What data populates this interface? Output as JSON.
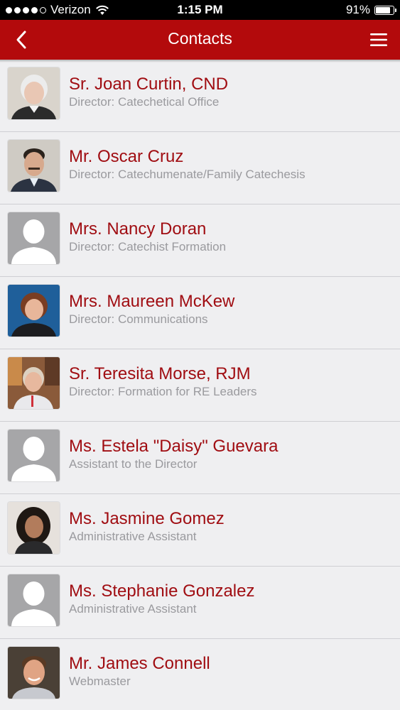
{
  "status_bar": {
    "carrier": "Verizon",
    "time": "1:15 PM",
    "battery": "91%",
    "battery_level": 0.91,
    "signal_bars_filled": 4,
    "signal_bars_total": 5
  },
  "header": {
    "title": "Contacts",
    "back_icon": "chevron-left-icon",
    "menu_icon": "hamburger-menu-icon",
    "background_color": "#b30a0c"
  },
  "colors": {
    "name": "#a00d12",
    "title": "#9a9a9e",
    "list_background": "#efeff1"
  },
  "contacts": [
    {
      "name": "Sr. Joan Curtin, CND",
      "title": "Director: Catechetical Office",
      "photo": "photo"
    },
    {
      "name": "Mr. Oscar Cruz",
      "title": "Director: Catechumenate/Family Catechesis",
      "photo": "photo"
    },
    {
      "name": "Mrs. Nancy Doran",
      "title": "Director: Catechist Formation",
      "photo": "placeholder"
    },
    {
      "name": "Mrs. Maureen McKew",
      "title": "Director: Communications",
      "photo": "photo"
    },
    {
      "name": "Sr. Teresita Morse, RJM",
      "title": "Director: Formation for RE Leaders",
      "photo": "photo"
    },
    {
      "name": "Ms. Estela \"Daisy\" Guevara",
      "title": "Assistant to the Director",
      "photo": "placeholder"
    },
    {
      "name": "Ms. Jasmine Gomez",
      "title": "Administrative Assistant",
      "photo": "photo"
    },
    {
      "name": "Ms. Stephanie Gonzalez",
      "title": "Administrative Assistant",
      "photo": "placeholder"
    },
    {
      "name": "Mr. James Connell",
      "title": "Webmaster",
      "photo": "photo"
    }
  ]
}
